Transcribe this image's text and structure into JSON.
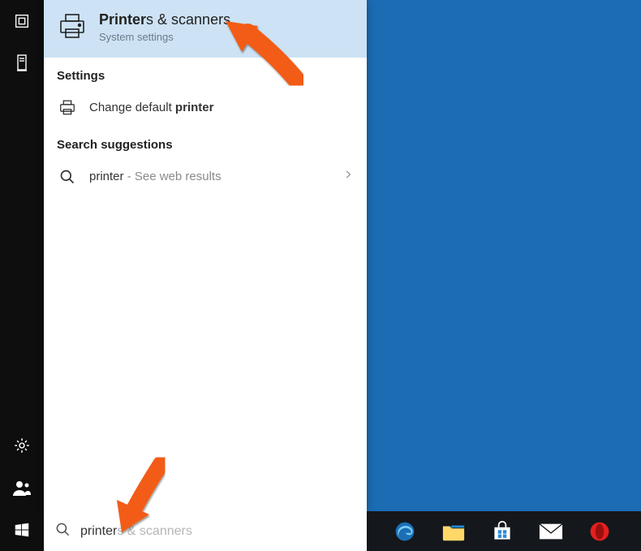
{
  "best_match": {
    "title_prefix": "Printer",
    "title_suffix": "s & scanners",
    "subtitle": "System settings"
  },
  "sections": {
    "settings": "Settings",
    "suggestions": "Search suggestions"
  },
  "settings_item": {
    "prefix": "Change default ",
    "bold": "printer"
  },
  "web_suggestion": {
    "query": "printer",
    "hint": " - See web results"
  },
  "search_input": {
    "typed": "printer",
    "suggestion": "s & scanners"
  },
  "rail": {
    "settings_label": "Settings",
    "people_label": "People",
    "start_label": "Start"
  },
  "taskbar": {
    "edge": "Microsoft Edge",
    "explorer": "File Explorer",
    "store": "Store",
    "mail": "Mail",
    "opera": "Opera"
  }
}
